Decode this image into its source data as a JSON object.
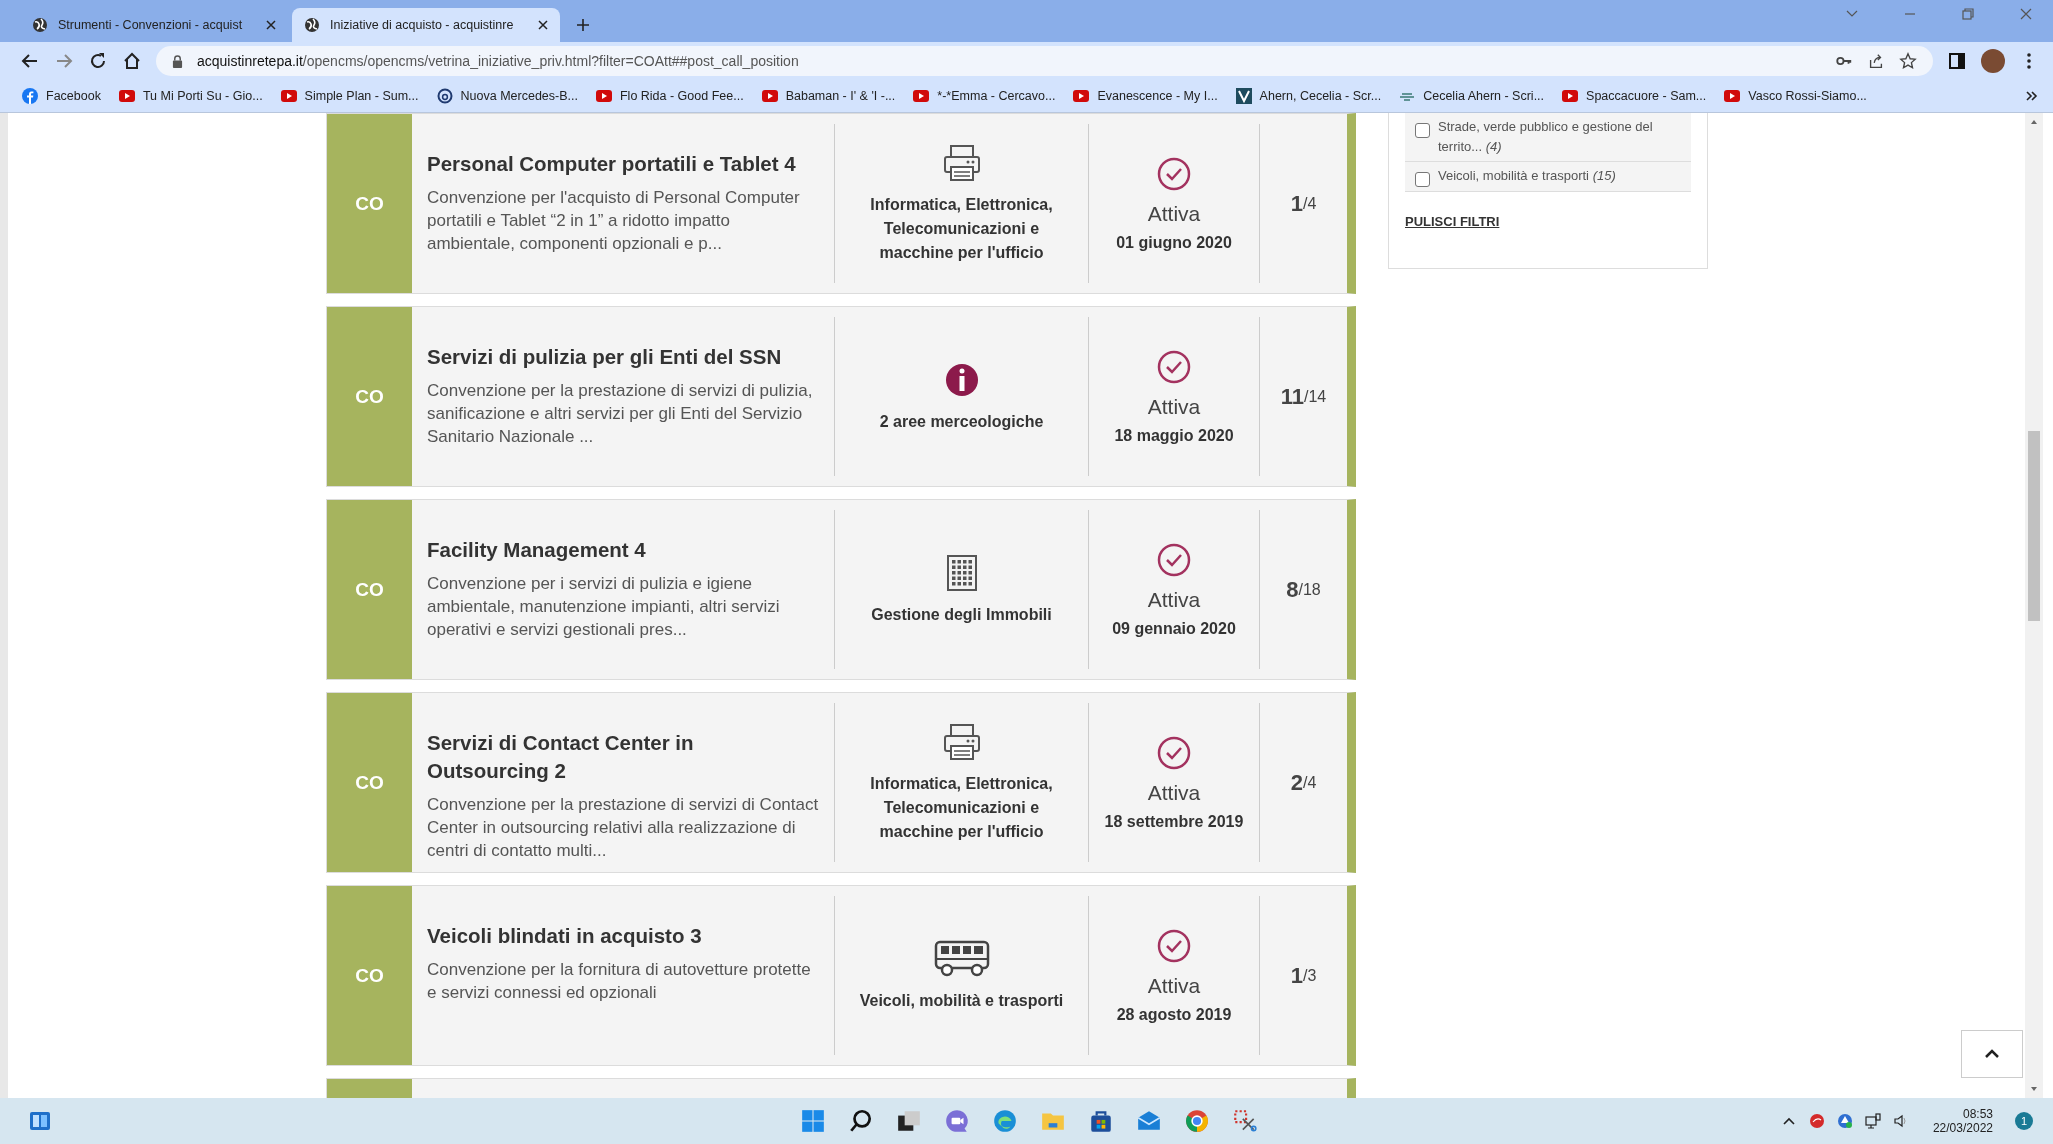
{
  "tabs": [
    {
      "title": "Strumenti - Convenzioni - acquist",
      "selected": false
    },
    {
      "title": "Iniziative di acquisto - acquistinre",
      "selected": true
    }
  ],
  "address": {
    "domain": "acquistinretepa.it",
    "path": "/opencms/opencms/vetrina_iniziative_priv.html?filter=COAtt##post_call_position"
  },
  "bookmarks": [
    {
      "label": "Facebook",
      "kind": "facebook"
    },
    {
      "label": "Tu Mi Porti Su - Gio...",
      "kind": "video"
    },
    {
      "label": "Simple Plan - Sum...",
      "kind": "video"
    },
    {
      "label": "Nuova Mercedes-B...",
      "kind": "ring"
    },
    {
      "label": "Flo Rida - Good Fee...",
      "kind": "video"
    },
    {
      "label": "Babaman - I' & 'I -...",
      "kind": "video"
    },
    {
      "label": "*-*Emma - Cercavo...",
      "kind": "video"
    },
    {
      "label": "Evanescence - My I...",
      "kind": "video"
    },
    {
      "label": "Ahern, Cecelia - Scr...",
      "kind": "square"
    },
    {
      "label": "Cecelia Ahern - Scri...",
      "kind": "mark"
    },
    {
      "label": "Spaccacuore - Sam...",
      "kind": "video"
    },
    {
      "label": "Vasco Rossi-Siamo...",
      "kind": "video"
    }
  ],
  "filters": [
    {
      "label": "Strade, verde pubblico e gestione del territo... *(4)*",
      "checked": false
    },
    {
      "label": "Veicoli, mobilità e trasporti *(15)*",
      "checked": false
    }
  ],
  "clear_filters": "PULISCI FILTRI",
  "cards": [
    {
      "type": "CO",
      "title": "Personal Computer portatili e Tablet 4",
      "description": "Convenzione per l'acquisto di Personal Computer portatili e Tablet “2 in 1” a ridotto impatto ambientale, componenti opzionali e p...",
      "kind": "printer",
      "category": "Informatica, Elettronica, Telecomunicazioni e macchine per l'ufficio",
      "status": "Attiva",
      "active": true,
      "date": "01 giugno 2020",
      "count": "1",
      "total": "/4"
    },
    {
      "type": "CO",
      "title": "Servizi di pulizia per gli Enti del SSN",
      "description": "Convenzione per la prestazione di servizi di pulizia, sanificazione e altri servizi per gli Enti del Servizio Sanitario Nazionale ...",
      "kind": "info",
      "category": "2 aree merceologiche",
      "status": "Attiva",
      "active": true,
      "date": "18 maggio 2020",
      "count": "11",
      "total": "/14"
    },
    {
      "type": "CO",
      "title": "Facility Management 4",
      "description": "Convenzione per i servizi di pulizia e igiene ambientale, manutenzione impianti, altri servizi operativi e servizi gestionali pres...",
      "kind": "building",
      "category": "Gestione degli Immobili",
      "status": "Attiva",
      "active": true,
      "date": "09 gennaio 2020",
      "count": "8",
      "total": "/18"
    },
    {
      "type": "CO",
      "title": "Servizi di Contact Center in Outsourcing 2",
      "description": "Convenzione per la prestazione di servizi di Contact Center in outsourcing relativi alla realizzazione di centri di contatto multi...",
      "kind": "printer",
      "category": "Informatica, Elettronica, Telecomunicazioni e macchine per l'ufficio",
      "status": "Attiva",
      "active": true,
      "date": "18 settembre 2019",
      "count": "2",
      "total": "/4"
    },
    {
      "type": "CO",
      "title": "Veicoli blindati in acquisto 3",
      "description": "Convenzione per la fornitura di autovetture protette e servizi connessi ed opzionali",
      "kind": "bus",
      "category": "Veicoli, mobilità e trasporti",
      "status": "Attiva",
      "active": true,
      "date": "28 agosto 2019",
      "count": "1",
      "total": "/3"
    }
  ],
  "taskbar": {
    "time": "08:53",
    "date": "22/03/2022",
    "notifications": "1"
  }
}
